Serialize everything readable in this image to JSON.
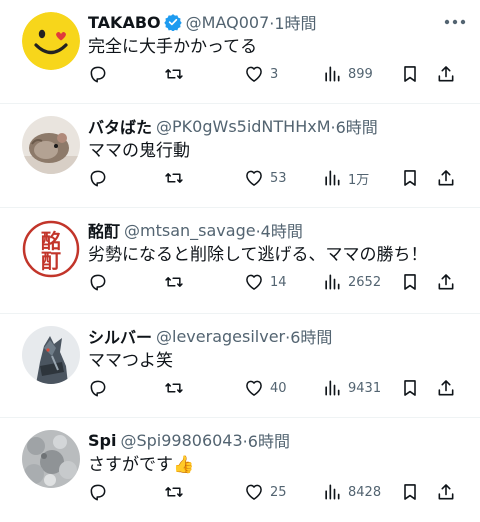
{
  "tweets": [
    {
      "name": "TAKABO",
      "verified": true,
      "handle": "@MAQ007",
      "time": "·1時間",
      "text": "完全に大手かかってる",
      "likes": "3",
      "views": "899",
      "avatar": "smiley-avatar"
    },
    {
      "name": "バタばた",
      "verified": false,
      "handle": "@PK0gWs5idNTHHxM",
      "time": "·6時間",
      "text": "ママの鬼行動",
      "likes": "53",
      "views": "1万",
      "avatar": "hamster-avatar"
    },
    {
      "name": "酩酊",
      "verified": false,
      "handle": "@mtsan_savage",
      "time": "·4時間",
      "text": "劣勢になると削除して逃げる、ママの勝ち！",
      "likes": "14",
      "views": "2652",
      "avatar": "kanji-seal-avatar",
      "avatar_glyph_top": "酩",
      "avatar_glyph_bottom": "酊"
    },
    {
      "name": "シルバー",
      "verified": false,
      "handle": "@leveragesilver",
      "time": "·6時間",
      "text": "ママつよ笑",
      "likes": "40",
      "views": "9431",
      "avatar": "wolf-warrior-avatar"
    },
    {
      "name": "Spi",
      "verified": false,
      "handle": "@Spi99806043",
      "time": "·6時間",
      "text": "さすがです👍",
      "likes": "25",
      "views": "8428",
      "avatar": "gray-texture-avatar"
    }
  ],
  "colors": {
    "text": "#0f1419",
    "muted": "#536471",
    "verified": "#1d9bf0",
    "divider": "#eff3f4",
    "smiley": "#f7d61b",
    "seal_red": "#c2352a"
  }
}
